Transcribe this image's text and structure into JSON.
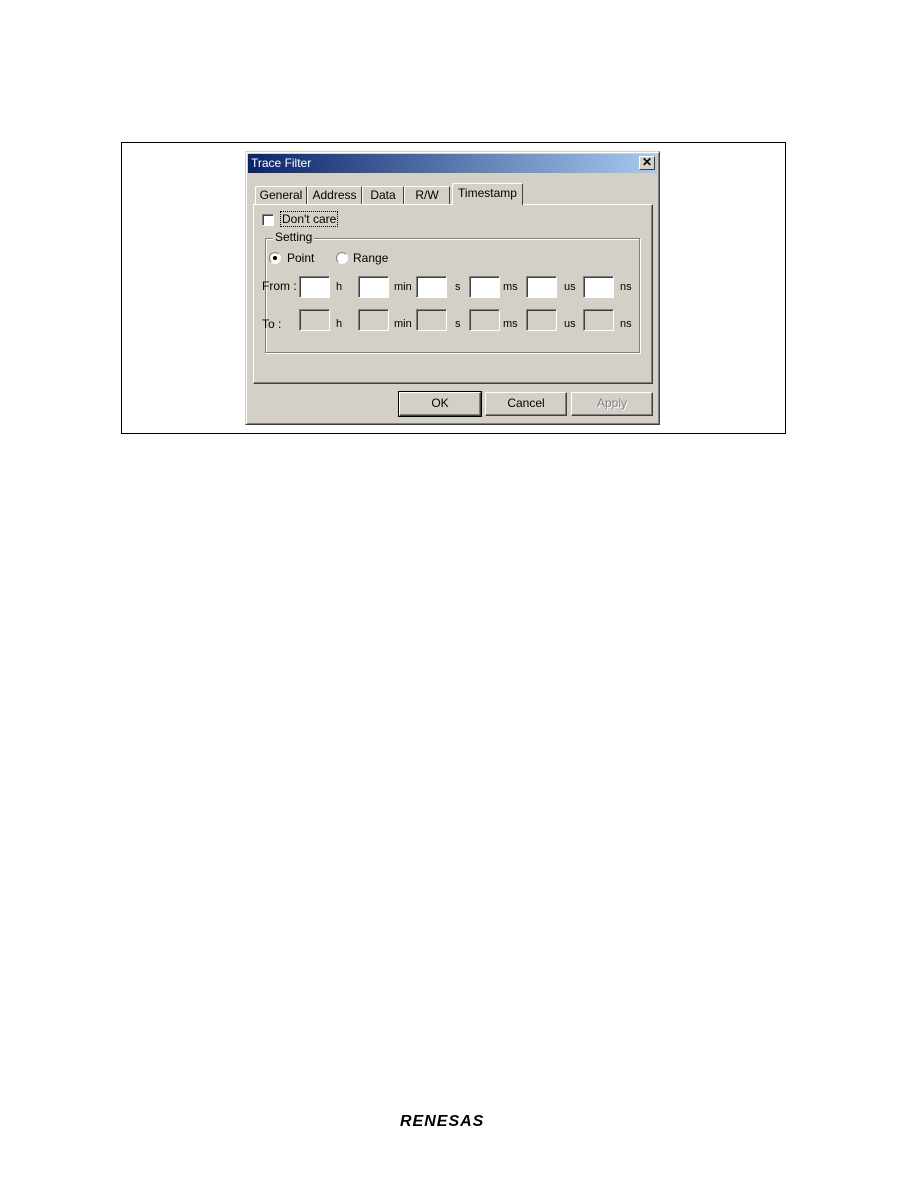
{
  "dialog": {
    "title": "Trace Filter",
    "close_glyph": "✕"
  },
  "tabs": [
    {
      "label": "General"
    },
    {
      "label": "Address"
    },
    {
      "label": "Data"
    },
    {
      "label": "R/W"
    },
    {
      "label": "Timestamp",
      "active": true
    }
  ],
  "panel": {
    "dont_care_label": "Don't care",
    "dont_care_checked": false,
    "group_label": "Setting",
    "radio_point": "Point",
    "radio_range": "Range",
    "selected_mode": "Point",
    "from_label": "From :",
    "to_label": "To :",
    "units": [
      "h",
      "min",
      "s",
      "ms",
      "us",
      "ns"
    ],
    "from_values": [
      "",
      "",
      "",
      "",
      "",
      ""
    ],
    "to_values": [
      "",
      "",
      "",
      "",
      "",
      ""
    ]
  },
  "buttons": {
    "ok": "OK",
    "cancel": "Cancel",
    "apply": "Apply"
  },
  "footer": {
    "logo_text": "RENESAS"
  },
  "colors": {
    "dialog_bg": "#d4d0c8",
    "titlebar_start": "#0a246a",
    "titlebar_end": "#a6caf0"
  }
}
